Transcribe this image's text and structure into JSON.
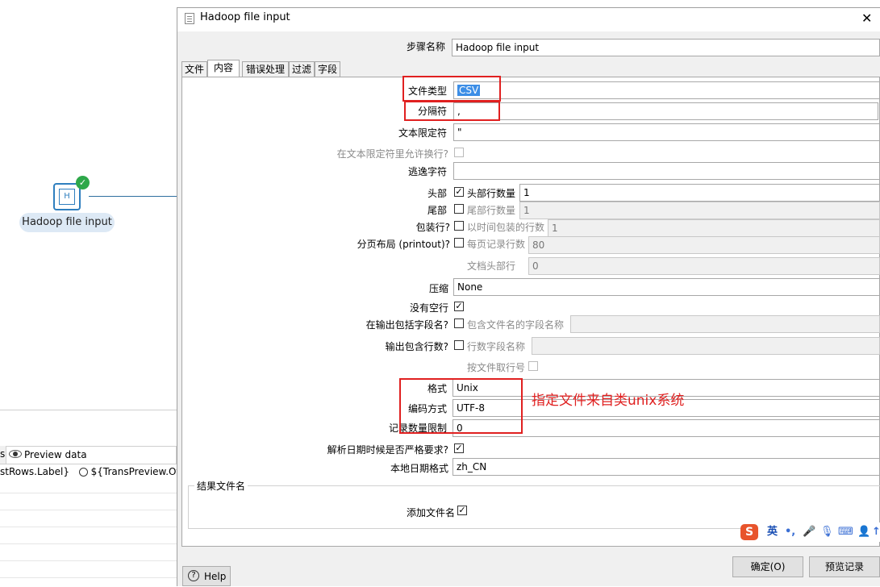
{
  "window": {
    "title": "Hadoop file input"
  },
  "canvas": {
    "node_label": "Hadoop file input",
    "node_icon": "hadoop-file-input-step-icon",
    "status": "success-check-icon",
    "preview_tab": "Preview data",
    "radio_left": "stRows.Label}",
    "radio_right": "${TransPreview.Off.L",
    "left_tab_fragment": "s"
  },
  "step_name": {
    "label": "步骤名称",
    "value": "Hadoop file input"
  },
  "tabs": [
    {
      "label": "文件"
    },
    {
      "label": "内容"
    },
    {
      "label": "错误处理"
    },
    {
      "label": "过滤"
    },
    {
      "label": "字段"
    }
  ],
  "content": {
    "file_type": {
      "label": "文件类型",
      "value": "CSV"
    },
    "separator": {
      "label": "分隔符",
      "value": ","
    },
    "enclosure": {
      "label": "文本限定符",
      "value": "\""
    },
    "allow_breaks": {
      "label": "在文本限定符里允许换行?"
    },
    "escape": {
      "label": "逃逸字符",
      "value": ""
    },
    "header": {
      "label": "头部",
      "sub_label": "头部行数量",
      "value": "1"
    },
    "footer": {
      "label": "尾部",
      "sub_label": "尾部行数量",
      "value": "1"
    },
    "wrapped": {
      "label": "包装行?",
      "sub_label": "以时间包装的行数",
      "value": "1"
    },
    "paged": {
      "label": "分页布局 (printout)?",
      "sub_label": "每页记录行数",
      "value": "80"
    },
    "doc_header": {
      "sub_label": "文档头部行",
      "value": "0"
    },
    "compression": {
      "label": "压缩",
      "value": "None"
    },
    "no_empty": {
      "label": "没有空行"
    },
    "include_filename": {
      "label": "在输出包括字段名?",
      "sub_label": "包含文件名的字段名称",
      "value": ""
    },
    "include_rownum": {
      "label": "输出包含行数?",
      "sub_label": "行数字段名称",
      "value": ""
    },
    "rownum_by_file": {
      "sub_label": "按文件取行号"
    },
    "format": {
      "label": "格式",
      "value": "Unix"
    },
    "encoding": {
      "label": "编码方式",
      "value": "UTF-8"
    },
    "limit": {
      "label": "记录数量限制",
      "value": "0"
    },
    "lenient_date": {
      "label": "解析日期时候是否严格要求?"
    },
    "date_locale": {
      "label": "本地日期格式",
      "value": "zh_CN"
    },
    "result_group": {
      "title": "结果文件名",
      "add_label": "添加文件名"
    }
  },
  "annotation": {
    "text": "指定文件来自类unix系统",
    "color": "#e02020"
  },
  "buttons": {
    "help": "Help",
    "ok": "确定(O)",
    "preview": "预览记录"
  },
  "ime": {
    "logo": "S",
    "lang": "英",
    "punct": "•,",
    "icons": [
      "microphone-icon",
      "keyboard-icon",
      "user-icon",
      "upload-icon"
    ]
  },
  "colors": {
    "accent": "#2f7fbf",
    "success": "#2ea84a",
    "annotation": "#e02020",
    "selection": "#3d8ee6"
  }
}
